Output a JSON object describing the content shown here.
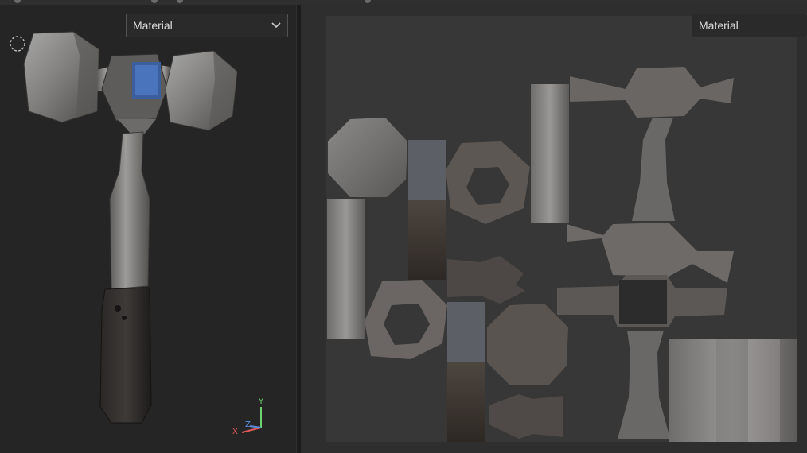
{
  "left_viewport": {
    "dropdown": {
      "selected": "Material"
    },
    "icons": [
      "camera-orbit-icon",
      "axis-gizmo-icon"
    ],
    "axis_gizmo": {
      "y_label": "Y",
      "z_label": "Z",
      "x_label": "X"
    }
  },
  "right_viewport": {
    "dropdown": {
      "selected": "Material"
    }
  },
  "colors": {
    "background": "#262626",
    "panel": "#2e2e2e",
    "uv_canvas": "#373737",
    "axis_x": "#e05a5a",
    "axis_y": "#6fd36f",
    "axis_z": "#5a8fe0"
  }
}
